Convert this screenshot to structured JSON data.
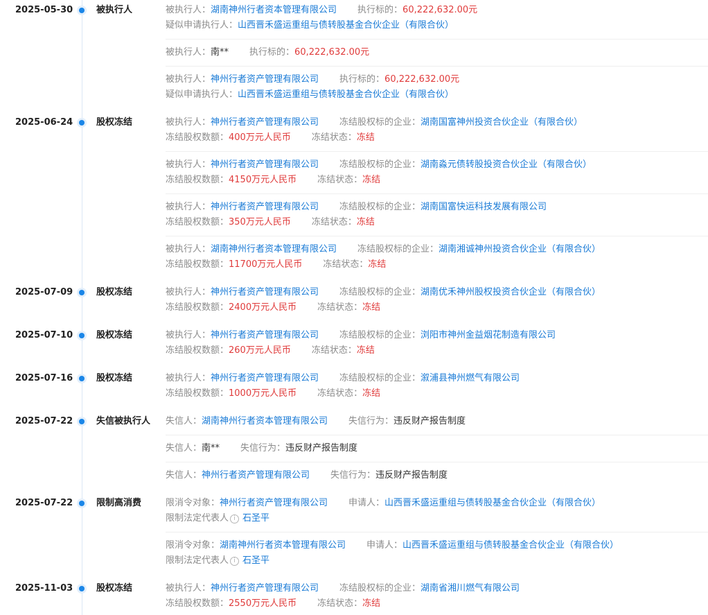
{
  "events": [
    {
      "date": "2025-05-30",
      "type": "被执行人",
      "entries": [
        {
          "lines": [
            [
              {
                "label": "被执行人：",
                "value": "湖南神州行者资本管理有限公司",
                "style": "blue"
              },
              {
                "label": "执行标的：",
                "value": "60,222,632.00元",
                "style": "red"
              }
            ],
            [
              {
                "label": "疑似申请执行人：",
                "value": "山西晋禾盛运重组与债转股基金合伙企业（有限合伙）",
                "style": "blue"
              }
            ]
          ]
        },
        {
          "lines": [
            [
              {
                "label": "被执行人：",
                "value": "南**",
                "style": "dark"
              },
              {
                "label": "执行标的：",
                "value": "60,222,632.00元",
                "style": "red"
              }
            ]
          ]
        },
        {
          "lines": [
            [
              {
                "label": "被执行人：",
                "value": "神州行者资产管理有限公司",
                "style": "blue"
              },
              {
                "label": "执行标的：",
                "value": "60,222,632.00元",
                "style": "red"
              }
            ],
            [
              {
                "label": "疑似申请执行人：",
                "value": "山西晋禾盛运重组与债转股基金合伙企业（有限合伙）",
                "style": "blue"
              }
            ]
          ]
        }
      ]
    },
    {
      "date": "2025-06-24",
      "type": "股权冻结",
      "entries": [
        {
          "lines": [
            [
              {
                "label": "被执行人：",
                "value": "神州行者资产管理有限公司",
                "style": "blue"
              },
              {
                "label": "冻结股权标的企业：",
                "value": "湖南国富神州投资合伙企业（有限合伙）",
                "style": "blue"
              }
            ],
            [
              {
                "label": "冻结股权数额：",
                "value": "400万元人民币",
                "style": "red"
              },
              {
                "label": "冻结状态：",
                "value": "冻结",
                "style": "red"
              }
            ]
          ]
        },
        {
          "lines": [
            [
              {
                "label": "被执行人：",
                "value": "神州行者资产管理有限公司",
                "style": "blue"
              },
              {
                "label": "冻结股权标的企业：",
                "value": "湖南淼元债转股投资合伙企业（有限合伙）",
                "style": "blue"
              }
            ],
            [
              {
                "label": "冻结股权数额：",
                "value": "4150万元人民币",
                "style": "red"
              },
              {
                "label": "冻结状态：",
                "value": "冻结",
                "style": "red"
              }
            ]
          ]
        },
        {
          "lines": [
            [
              {
                "label": "被执行人：",
                "value": "神州行者资产管理有限公司",
                "style": "blue"
              },
              {
                "label": "冻结股权标的企业：",
                "value": "湖南国富快运科技发展有限公司",
                "style": "blue"
              }
            ],
            [
              {
                "label": "冻结股权数额：",
                "value": "350万元人民币",
                "style": "red"
              },
              {
                "label": "冻结状态：",
                "value": "冻结",
                "style": "red"
              }
            ]
          ]
        },
        {
          "lines": [
            [
              {
                "label": "被执行人：",
                "value": "湖南神州行者资本管理有限公司",
                "style": "blue"
              },
              {
                "label": "冻结股权标的企业：",
                "value": "湖南湘诚神州投资合伙企业（有限合伙）",
                "style": "blue"
              }
            ],
            [
              {
                "label": "冻结股权数额：",
                "value": "11700万元人民币",
                "style": "red"
              },
              {
                "label": "冻结状态：",
                "value": "冻结",
                "style": "red"
              }
            ]
          ]
        }
      ]
    },
    {
      "date": "2025-07-09",
      "type": "股权冻结",
      "entries": [
        {
          "lines": [
            [
              {
                "label": "被执行人：",
                "value": "神州行者资产管理有限公司",
                "style": "blue"
              },
              {
                "label": "冻结股权标的企业：",
                "value": "湖南优禾神州股权投资合伙企业（有限合伙）",
                "style": "blue"
              }
            ],
            [
              {
                "label": "冻结股权数额：",
                "value": "2400万元人民币",
                "style": "red"
              },
              {
                "label": "冻结状态：",
                "value": "冻结",
                "style": "red"
              }
            ]
          ]
        }
      ]
    },
    {
      "date": "2025-07-10",
      "type": "股权冻结",
      "entries": [
        {
          "lines": [
            [
              {
                "label": "被执行人：",
                "value": "神州行者资产管理有限公司",
                "style": "blue"
              },
              {
                "label": "冻结股权标的企业：",
                "value": "浏阳市神州金益烟花制造有限公司",
                "style": "blue"
              }
            ],
            [
              {
                "label": "冻结股权数额：",
                "value": "260万元人民币",
                "style": "red"
              },
              {
                "label": "冻结状态：",
                "value": "冻结",
                "style": "red"
              }
            ]
          ]
        }
      ]
    },
    {
      "date": "2025-07-16",
      "type": "股权冻结",
      "entries": [
        {
          "lines": [
            [
              {
                "label": "被执行人：",
                "value": "神州行者资产管理有限公司",
                "style": "blue"
              },
              {
                "label": "冻结股权标的企业：",
                "value": "溆浦县神州燃气有限公司",
                "style": "blue"
              }
            ],
            [
              {
                "label": "冻结股权数额：",
                "value": "1000万元人民币",
                "style": "red"
              },
              {
                "label": "冻结状态：",
                "value": "冻结",
                "style": "red"
              }
            ]
          ]
        }
      ]
    },
    {
      "date": "2025-07-22",
      "type": "失信被执行人",
      "entries": [
        {
          "lines": [
            [
              {
                "label": "失信人：",
                "value": "湖南神州行者资本管理有限公司",
                "style": "blue"
              },
              {
                "label": "失信行为：",
                "value": "违反财产报告制度",
                "style": "dark"
              }
            ]
          ]
        },
        {
          "lines": [
            [
              {
                "label": "失信人：",
                "value": "南**",
                "style": "dark"
              },
              {
                "label": "失信行为：",
                "value": "违反财产报告制度",
                "style": "dark"
              }
            ]
          ]
        },
        {
          "lines": [
            [
              {
                "label": "失信人：",
                "value": "神州行者资产管理有限公司",
                "style": "blue"
              },
              {
                "label": "失信行为：",
                "value": "违反财产报告制度",
                "style": "dark"
              }
            ]
          ]
        }
      ]
    },
    {
      "date": "2025-07-22",
      "type": "限制高消费",
      "entries": [
        {
          "lines": [
            [
              {
                "label": "限消令对象：",
                "value": "神州行者资产管理有限公司",
                "style": "blue"
              },
              {
                "label": "申请人：",
                "value": "山西晋禾盛运重组与债转股基金合伙企业（有限合伙）",
                "style": "blue"
              }
            ],
            [
              {
                "label": "限制法定代表人",
                "info": true,
                "value": "石圣平",
                "style": "blue"
              }
            ]
          ]
        },
        {
          "lines": [
            [
              {
                "label": "限消令对象：",
                "value": "湖南神州行者资本管理有限公司",
                "style": "blue"
              },
              {
                "label": "申请人：",
                "value": "山西晋禾盛运重组与债转股基金合伙企业（有限合伙）",
                "style": "blue"
              }
            ],
            [
              {
                "label": "限制法定代表人",
                "info": true,
                "value": "石圣平",
                "style": "blue"
              }
            ]
          ]
        }
      ]
    },
    {
      "date": "2025-11-03",
      "type": "股权冻结",
      "entries": [
        {
          "lines": [
            [
              {
                "label": "被执行人：",
                "value": "神州行者资产管理有限公司",
                "style": "blue"
              },
              {
                "label": "冻结股权标的企业：",
                "value": "湖南省湘川燃气有限公司",
                "style": "blue"
              }
            ],
            [
              {
                "label": "冻结股权数额：",
                "value": "2550万元人民币",
                "style": "red"
              },
              {
                "label": "冻结状态：",
                "value": "冻结",
                "style": "red"
              }
            ]
          ]
        }
      ]
    }
  ],
  "info_icon": "info-icon",
  "colors": {
    "accent": "#1a7bd6",
    "danger": "#e03b3b",
    "label": "#8c8c8c",
    "dot": "#1a86e8"
  }
}
